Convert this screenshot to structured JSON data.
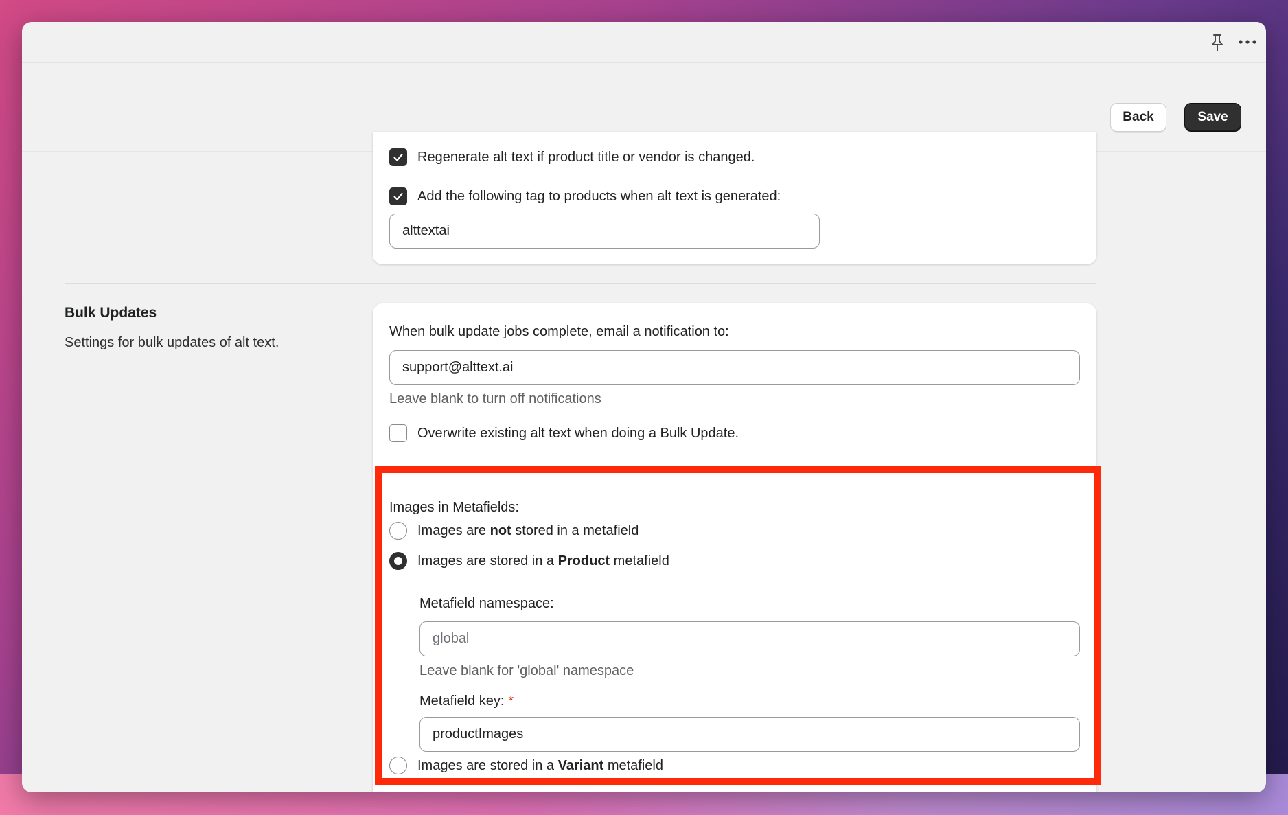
{
  "window": {
    "pin_icon": "pin-icon",
    "more_icon": "more-icon"
  },
  "toolbar": {
    "back_label": "Back",
    "save_label": "Save"
  },
  "tagging": {
    "regenerate_label": "Regenerate alt text if product title or vendor is changed.",
    "regenerate_checked": true,
    "add_tag_label": "Add the following tag to products when alt text is generated:",
    "add_tag_checked": true,
    "tag_value": "alttextai"
  },
  "bulk": {
    "title": "Bulk Updates",
    "description": "Settings for bulk updates of alt text.",
    "email_label": "When bulk update jobs complete, email a notification to:",
    "email_value": "support@alttext.ai",
    "email_help": "Leave blank to turn off notifications",
    "overwrite_label": "Overwrite existing alt text when doing a Bulk Update.",
    "overwrite_checked": false
  },
  "metafields": {
    "heading": "Images in Metafields:",
    "option_none": {
      "pre": "Images are ",
      "bold": "not",
      "post": " stored in a metafield"
    },
    "option_product": {
      "pre": "Images are stored in a ",
      "bold": "Product",
      "post": " metafield"
    },
    "option_variant": {
      "pre": "Images are stored in a ",
      "bold": "Variant",
      "post": " metafield"
    },
    "selected": "product",
    "namespace_label": "Metafield namespace:",
    "namespace_placeholder": "global",
    "namespace_help": "Leave blank for 'global' namespace",
    "key_label": "Metafield key:",
    "key_required_mark": "*",
    "key_value": "productImages"
  },
  "colors": {
    "highlight": "#ff2a0a",
    "primary_button": "#303030"
  }
}
